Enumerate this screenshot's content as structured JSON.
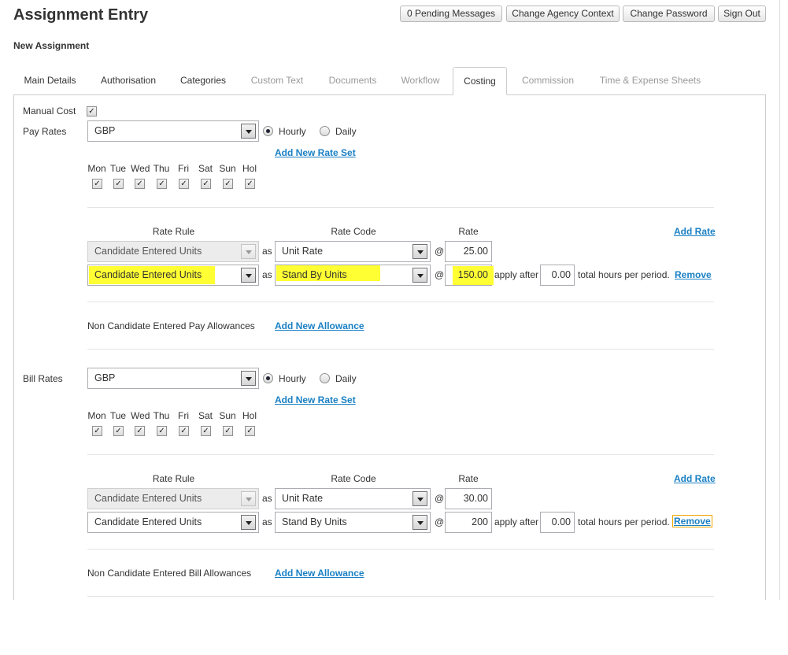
{
  "page": {
    "title": "Assignment Entry",
    "subtitle": "New Assignment"
  },
  "header_buttons": {
    "pending": "0 Pending Messages",
    "agency": "Change Agency Context",
    "password": "Change Password",
    "signout": "Sign Out"
  },
  "tabs": [
    {
      "label": "Main Details",
      "state": "enabled"
    },
    {
      "label": "Authorisation",
      "state": "enabled"
    },
    {
      "label": "Categories",
      "state": "enabled"
    },
    {
      "label": "Custom Text",
      "state": "disabled"
    },
    {
      "label": "Documents",
      "state": "disabled"
    },
    {
      "label": "Workflow",
      "state": "disabled"
    },
    {
      "label": "Costing",
      "state": "active"
    },
    {
      "label": "Commission",
      "state": "disabled"
    },
    {
      "label": "Time & Expense Sheets",
      "state": "disabled"
    }
  ],
  "manual_cost": {
    "label": "Manual Cost",
    "checked": true
  },
  "days": [
    "Mon",
    "Tue",
    "Wed",
    "Thu",
    "Fri",
    "Sat",
    "Sun",
    "Hol"
  ],
  "columns": {
    "rate_rule": "Rate Rule",
    "rate_code": "Rate Code",
    "rate": "Rate"
  },
  "words": {
    "as": "as",
    "at": "@",
    "apply_after": "apply after",
    "total_hours": "total hours per period."
  },
  "pay": {
    "label": "Pay Rates",
    "currency": "GBP",
    "hourly": "Hourly",
    "daily": "Daily",
    "add_rate_set": "Add New Rate Set",
    "add_rate": "Add Rate",
    "rows": [
      {
        "rule": "Candidate Entered Units",
        "code": "Unit Rate",
        "rate": "25.00"
      },
      {
        "rule": "Candidate Entered Units",
        "code": "Stand By Units",
        "rate": "150.00",
        "after": "0.00",
        "remove": "Remove"
      }
    ],
    "allowances_label": "Non Candidate Entered Pay Allowances",
    "add_allowance": "Add New Allowance"
  },
  "bill": {
    "label": "Bill Rates",
    "currency": "GBP",
    "hourly": "Hourly",
    "daily": "Daily",
    "add_rate_set": "Add New Rate Set",
    "add_rate": "Add Rate",
    "rows": [
      {
        "rule": "Candidate Entered Units",
        "code": "Unit Rate",
        "rate": "30.00"
      },
      {
        "rule": "Candidate Entered Units",
        "code": "Stand By Units",
        "rate": "200",
        "after": "0.00",
        "remove": "Remove"
      }
    ],
    "allowances_label": "Non Candidate Entered Bill Allowances",
    "add_allowance": "Add New Allowance"
  },
  "colors": {
    "highlight": "#ffff33",
    "link": "#1a80c4"
  }
}
